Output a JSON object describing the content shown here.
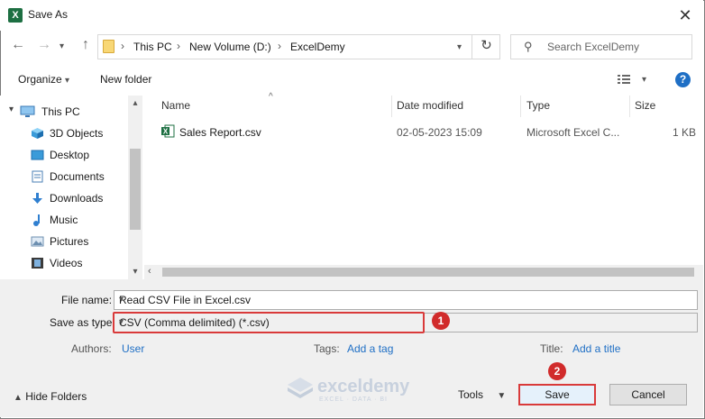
{
  "window": {
    "title": "Save As",
    "app_icon": "excel-icon",
    "close_glyph": "✕"
  },
  "nav": {
    "back": "←",
    "forward": "→",
    "up": "↑"
  },
  "address": {
    "crumbs": [
      "This PC",
      "New Volume (D:)",
      "ExcelDemy"
    ],
    "separator": "›",
    "refresh": "↻"
  },
  "search": {
    "placeholder": "Search ExcelDemy"
  },
  "toolbar": {
    "organize": "Organize",
    "new_folder": "New folder",
    "help": "?"
  },
  "sidebar": {
    "items": [
      {
        "label": "This PC",
        "icon": "pc-icon"
      },
      {
        "label": "3D Objects",
        "icon": "cube-icon"
      },
      {
        "label": "Desktop",
        "icon": "desktop-icon"
      },
      {
        "label": "Documents",
        "icon": "documents-icon"
      },
      {
        "label": "Downloads",
        "icon": "download-icon"
      },
      {
        "label": "Music",
        "icon": "music-icon"
      },
      {
        "label": "Pictures",
        "icon": "pictures-icon"
      },
      {
        "label": "Videos",
        "icon": "videos-icon"
      }
    ]
  },
  "files": {
    "columns": {
      "name": "Name",
      "date": "Date modified",
      "type": "Type",
      "size": "Size"
    },
    "rows": [
      {
        "name": "Sales Report.csv",
        "date": "02-05-2023 15:09",
        "type": "Microsoft Excel C...",
        "size": "1 KB",
        "icon": "excel-csv-icon"
      }
    ]
  },
  "form": {
    "file_name_label": "File name:",
    "file_name_value": "Read CSV File in Excel.csv",
    "save_type_label": "Save as type:",
    "save_type_value": "CSV (Comma delimited) (*.csv)",
    "authors_label": "Authors:",
    "authors_value": "User",
    "tags_label": "Tags:",
    "tags_value": "Add a tag",
    "title_label": "Title:",
    "title_value": "Add a title"
  },
  "footer": {
    "hide_folders": "Hide Folders",
    "tools": "Tools",
    "save": "Save",
    "cancel": "Cancel"
  },
  "annotations": {
    "badge1": "1",
    "badge2": "2",
    "highlight_color": "#d93a3a"
  },
  "watermark": {
    "brand": "exceldemy",
    "tagline": "EXCEL · DATA · BI"
  }
}
